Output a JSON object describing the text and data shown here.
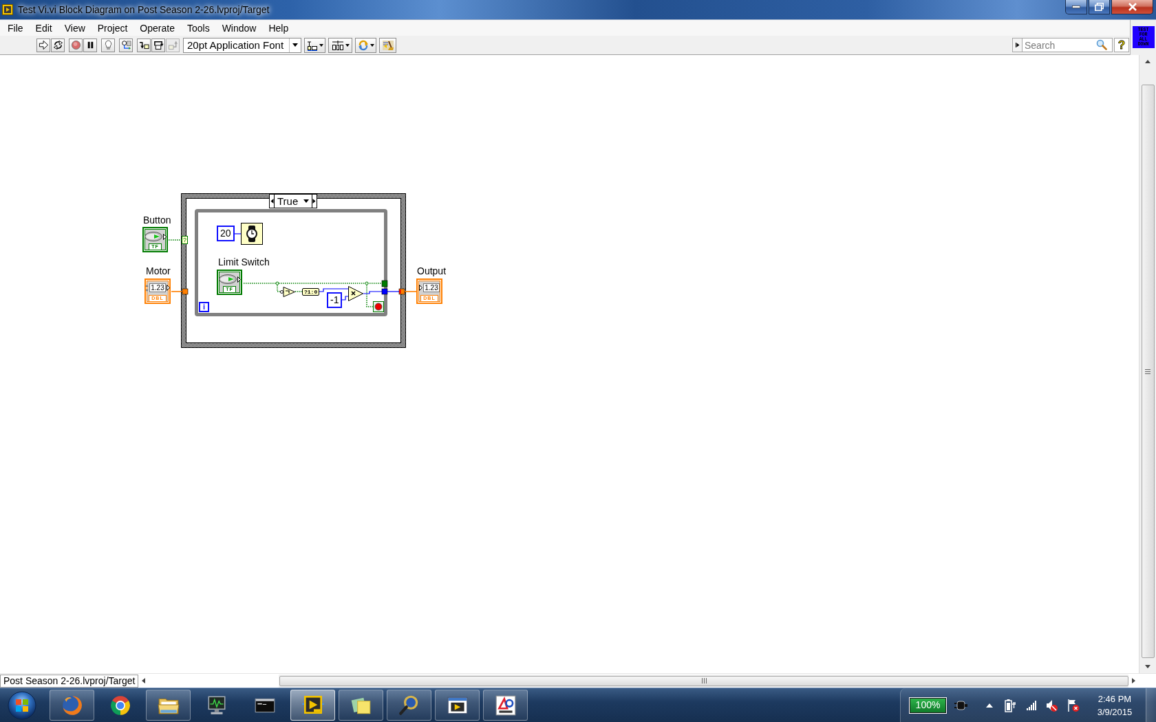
{
  "window": {
    "title": "Test Vi.vi Block Diagram on Post Season 2-26.lvproj/Target"
  },
  "menu": [
    "File",
    "Edit",
    "View",
    "Project",
    "Operate",
    "Tools",
    "Window",
    "Help"
  ],
  "toolbar": {
    "buttons": [
      {
        "kind": "run",
        "disabled": false
      },
      {
        "kind": "run_continuously",
        "disabled": false
      },
      {
        "kind": "abort",
        "disabled": false
      },
      {
        "kind": "pause",
        "disabled": false
      },
      {
        "kind": "highlight",
        "disabled": false
      },
      {
        "kind": "retain_values",
        "disabled": false
      },
      {
        "kind": "step_into",
        "disabled": false
      },
      {
        "kind": "step_over",
        "disabled": false
      },
      {
        "kind": "step_out",
        "disabled": true
      }
    ],
    "font": "20pt Application Font",
    "tools": [
      {
        "kind": "align"
      },
      {
        "kind": "distribute"
      },
      {
        "kind": "reorder"
      },
      {
        "kind": "cleanup"
      }
    ],
    "search": {
      "placeholder": "Search"
    },
    "help": "?",
    "vi_icon": "TEST FOR ALL DOWN"
  },
  "diagram": {
    "terminals": [
      {
        "kind": "boolean_control",
        "label": "Button",
        "data_type": "TF"
      },
      {
        "kind": "numeric_control",
        "label": "Motor",
        "value": "1.23",
        "data_type": "DBL"
      },
      {
        "kind": "numeric_indicator",
        "label": "Output",
        "value": "1.23",
        "data_type": "DBL"
      }
    ],
    "case_structure": {
      "selector": "True",
      "selector_terminal": "?"
    },
    "while_loop": {
      "iteration": "i",
      "nodes": [
        {
          "kind": "constant",
          "value": "20"
        },
        {
          "kind": "wait"
        },
        {
          "kind": "boolean_control",
          "label": "Limit Switch",
          "data_type": "TF"
        },
        {
          "kind": "not"
        },
        {
          "kind": "bool_to_number",
          "text": "?1:0"
        },
        {
          "kind": "constant",
          "value": "-1"
        },
        {
          "kind": "multiply"
        },
        {
          "kind": "stop"
        }
      ]
    }
  },
  "status_bar": {
    "path": "Post Season 2-26.lvproj/Target"
  },
  "taskbar": {
    "apps": [
      {
        "kind": "fox_globe",
        "running": true,
        "selected": false
      },
      {
        "kind": "color_ring",
        "running": false,
        "selected": false
      },
      {
        "kind": "folder",
        "running": true,
        "selected": false
      },
      {
        "kind": "monitor",
        "running": false,
        "selected": false
      },
      {
        "kind": "console",
        "running": false,
        "selected": false
      },
      {
        "kind": "play_block",
        "running": true,
        "selected": true
      },
      {
        "kind": "notes",
        "running": true,
        "selected": false
      },
      {
        "kind": "magnifier",
        "running": true,
        "selected": false
      },
      {
        "kind": "film",
        "running": true,
        "selected": false
      },
      {
        "kind": "logo",
        "running": true,
        "selected": false
      }
    ],
    "battery": {
      "reading": "100%",
      "level": 1
    },
    "clock": {
      "time": "2:46 PM",
      "date": "3/9/2015"
    }
  }
}
